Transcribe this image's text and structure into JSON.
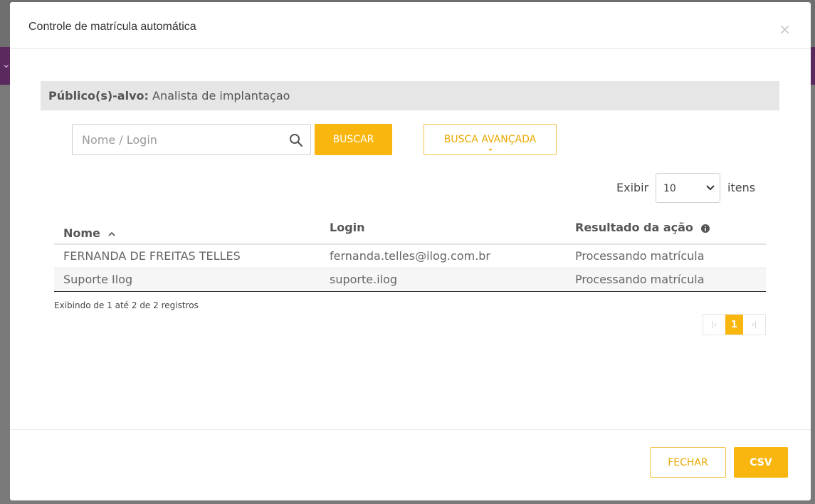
{
  "modal": {
    "title": "Controle de matrícula automática",
    "close_glyph": "×"
  },
  "target": {
    "label": "Público(s)-alvo:",
    "value": "Analista de implantaçao"
  },
  "search": {
    "placeholder": "Nome / Login",
    "buscar_label": "BUSCAR",
    "avancada_label": "BUSCA AVANÇADA"
  },
  "paging_size": {
    "prefix": "Exibir",
    "value": "10",
    "suffix": "itens"
  },
  "table": {
    "columns": [
      "Nome",
      "Login",
      "Resultado da ação"
    ],
    "rows": [
      [
        "FERNANDA DE FREITAS TELLES",
        "fernanda.telles@ilog.com.br",
        "Processando matrícula"
      ],
      [
        "Suporte Ilog",
        "suporte.ilog",
        "Processando matrícula"
      ]
    ]
  },
  "records_info": "Exibindo de 1 até 2 de 2 registros",
  "pagination": {
    "first_glyph": "|‹",
    "current_page": "1",
    "last_glyph": "›|"
  },
  "footer": {
    "fechar_label": "FECHAR",
    "csv_label": "CSV"
  },
  "colors": {
    "accent": "#f9b60f",
    "backdrop_purple": "#5a2a5e"
  },
  "icons": [
    "close-icon",
    "search-icon",
    "chevron-down-icon",
    "sort-ascending-icon",
    "info-icon",
    "first-page-icon",
    "last-page-icon"
  ]
}
